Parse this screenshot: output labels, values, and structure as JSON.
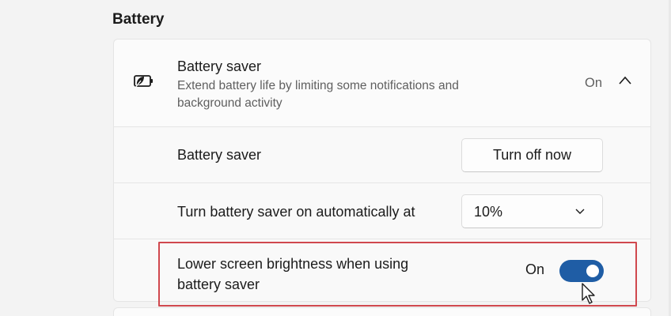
{
  "section": {
    "title": "Battery"
  },
  "battery_saver_card": {
    "icon": "battery-saver-leaf-icon",
    "title": "Battery saver",
    "description": "Extend battery life by limiting some notifications and background activity",
    "status": "On",
    "expanded": true
  },
  "rows": {
    "battery_saver": {
      "label": "Battery saver",
      "button_label": "Turn off now"
    },
    "auto_on": {
      "label": "Turn battery saver on automatically at",
      "selected_value": "10%"
    },
    "lower_brightness": {
      "label": "Lower screen brightness when using battery saver",
      "toggle_status": "On",
      "toggle_on": true
    }
  },
  "colors": {
    "accent": "#1f5da5",
    "highlight_border": "#d0484e",
    "background": "#f3f3f3",
    "card": "#fbfbfb"
  }
}
